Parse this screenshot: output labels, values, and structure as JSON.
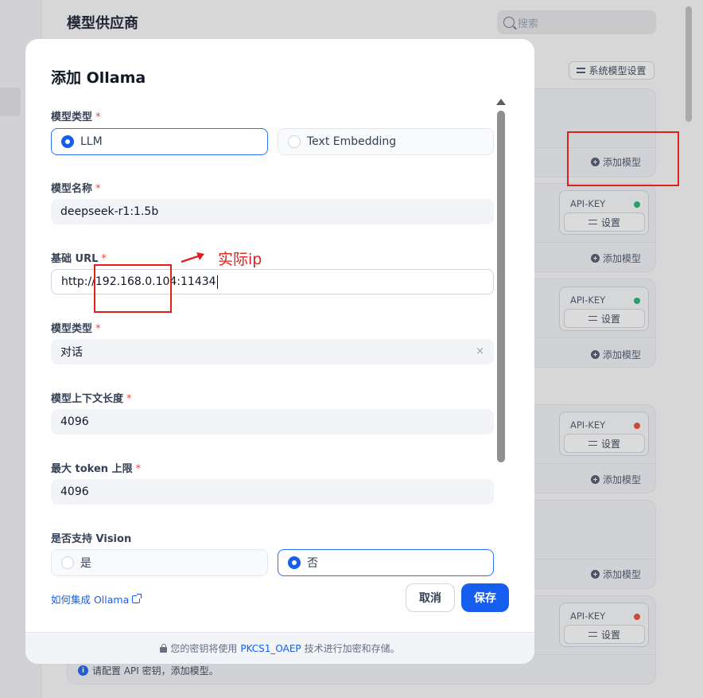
{
  "background": {
    "title": "模型供应商",
    "search_placeholder": "搜索",
    "system_model_settings": "系统模型设置",
    "add_model_label": "添加模型",
    "api_key_label": "API-KEY",
    "settings_label": "设置",
    "info_text": "请配置 API 密钥，添加模型。",
    "status_colors": {
      "ok": "#12b76a",
      "error": "#f04438"
    }
  },
  "modal": {
    "title": "添加 Ollama",
    "fields": {
      "model_type": {
        "label": "模型类型",
        "required": "*",
        "options": [
          "LLM",
          "Text Embedding"
        ],
        "selected": "LLM"
      },
      "model_name": {
        "label": "模型名称",
        "required": "*",
        "value": "deepseek-r1:1.5b"
      },
      "base_url": {
        "label": "基础 URL",
        "required": "*",
        "value": "http://192.168.0.104:11434"
      },
      "model_type2": {
        "label": "模型类型",
        "required": "*",
        "value": "对话",
        "clear_icon": "×"
      },
      "context_length": {
        "label": "模型上下文长度",
        "required": "*",
        "value": "4096"
      },
      "max_token": {
        "label": "最大 token 上限",
        "required": "*",
        "value": "4096"
      },
      "vision": {
        "label": "是否支持 Vision",
        "options": [
          "是",
          "否"
        ],
        "selected": "否"
      }
    },
    "help_link": "如何集成 Ollama",
    "cancel": "取消",
    "save": "保存",
    "footer": {
      "prefix": "您的密钥将使用",
      "highlight": "PKCS1_OAEP",
      "suffix": "技术进行加密和存储。"
    }
  },
  "annotation": {
    "label": "实际ip",
    "color": "#e0201b"
  }
}
